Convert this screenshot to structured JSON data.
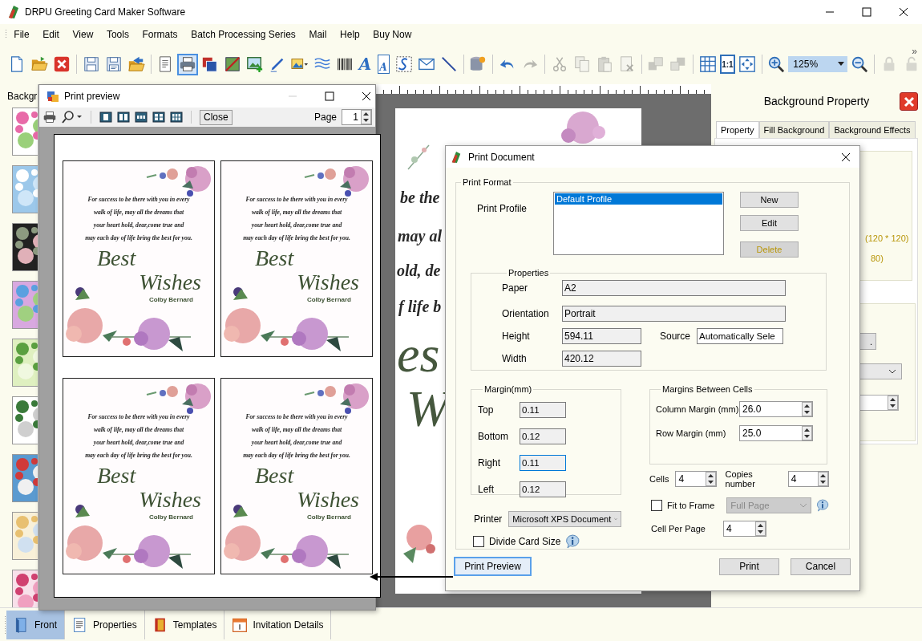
{
  "window": {
    "title": "DRPU Greeting Card Maker Software"
  },
  "menu": [
    "File",
    "Edit",
    "View",
    "Tools",
    "Formats",
    "Batch Processing Series",
    "Mail",
    "Help",
    "Buy Now"
  ],
  "toolbar": {
    "overflow": "»",
    "groups": [
      [
        {
          "kind": "button",
          "selected": false,
          "disabled": false
        },
        {
          "kind": "button",
          "selected": false,
          "disabled": false
        },
        {
          "kind": "button",
          "selected": false,
          "disabled": false
        }
      ],
      [
        {
          "kind": "button",
          "selected": false,
          "disabled": false
        },
        {
          "kind": "button",
          "selected": false,
          "disabled": false
        },
        {
          "kind": "button",
          "selected": false,
          "disabled": false
        }
      ],
      [
        {
          "kind": "button",
          "selected": false,
          "disabled": false
        },
        {
          "kind": "button",
          "selected": true,
          "disabled": false
        },
        {
          "kind": "button",
          "selected": false,
          "disabled": false
        },
        {
          "kind": "button",
          "selected": false,
          "disabled": false
        },
        {
          "kind": "button",
          "selected": false,
          "disabled": false
        },
        {
          "kind": "button",
          "selected": false,
          "disabled": false
        },
        {
          "kind": "button",
          "selected": false,
          "disabled": false
        },
        {
          "kind": "button",
          "selected": false,
          "disabled": false
        },
        {
          "kind": "button",
          "selected": false,
          "disabled": false
        },
        {
          "kind": "button",
          "label": "A",
          "selected": false,
          "disabled": false
        },
        {
          "kind": "button",
          "label": "A",
          "selected": false,
          "disabled": false
        },
        {
          "kind": "button",
          "selected": false,
          "disabled": false
        },
        {
          "kind": "button",
          "selected": false,
          "disabled": false
        },
        {
          "kind": "button",
          "selected": false,
          "disabled": false
        }
      ],
      [
        {
          "kind": "button",
          "selected": false,
          "disabled": false
        }
      ],
      [
        {
          "kind": "button",
          "selected": false,
          "disabled": false
        },
        {
          "kind": "button",
          "selected": false,
          "disabled": true
        }
      ],
      [
        {
          "kind": "button",
          "selected": false,
          "disabled": true
        },
        {
          "kind": "button",
          "selected": false,
          "disabled": true
        },
        {
          "kind": "button",
          "selected": false,
          "disabled": true
        },
        {
          "kind": "button",
          "selected": false,
          "disabled": true
        }
      ],
      [
        {
          "kind": "button",
          "selected": false,
          "disabled": true
        },
        {
          "kind": "button",
          "selected": false,
          "disabled": true
        }
      ],
      [
        {
          "kind": "button",
          "selected": false,
          "disabled": false
        },
        {
          "kind": "button",
          "label": "1:1",
          "selected": false,
          "disabled": false
        },
        {
          "kind": "button",
          "selected": false,
          "disabled": false
        }
      ],
      [
        {
          "kind": "button",
          "selected": false,
          "disabled": false
        },
        {
          "kind": "combo",
          "value": "125%"
        },
        {
          "kind": "button",
          "selected": false,
          "disabled": false
        }
      ],
      [
        {
          "kind": "button",
          "selected": false,
          "disabled": true
        },
        {
          "kind": "button",
          "selected": false,
          "disabled": true
        }
      ]
    ]
  },
  "left_panel": {
    "label": "Backgr"
  },
  "canvas": {
    "fragments": [
      {
        "kind": "line",
        "text": "be the"
      },
      {
        "kind": "line",
        "text": "may al"
      },
      {
        "kind": "line",
        "text": "old, de"
      },
      {
        "kind": "line",
        "text": "f life b"
      },
      {
        "kind": "title",
        "text": "es"
      },
      {
        "kind": "title",
        "text": "W"
      }
    ]
  },
  "background_property": {
    "title": "Background Property",
    "tabs": [
      {
        "label": "Property",
        "selected": true
      },
      {
        "label": "Fill Background",
        "selected": false
      },
      {
        "label": "Background Effects",
        "selected": false
      }
    ],
    "size_texts": [
      "(120 * 120)",
      "80)"
    ],
    "more_button": "."
  },
  "print_preview": {
    "title": "Print preview",
    "close_label": "Close",
    "page_label": "Page",
    "page": "1",
    "cards": [
      {
        "quote": [
          "For success to be there with you in every",
          "walk of life, may all the dreams that",
          "your heart hold, dear,come true and",
          "may each day of life bring the best for you."
        ],
        "title": [
          "Best",
          "Wishes"
        ],
        "name": "Colby Bernard"
      },
      {
        "quote": [
          "For success to be there with you in every",
          "walk of life, may all the dreams that",
          "your heart hold, dear,come true and",
          "may each day of life bring the best for you."
        ],
        "title": [
          "Best",
          "Wishes"
        ],
        "name": "Colby Bernard"
      },
      {
        "quote": [
          "For success to be there with you in every",
          "walk of life, may all the dreams that",
          "your heart hold, dear,come true and",
          "may each day of life bring the best for you."
        ],
        "title": [
          "Best",
          "Wishes"
        ],
        "name": "Colby Bernard"
      },
      {
        "quote": [
          "For success to be there with you in every",
          "walk of life, may all the dreams that",
          "your heart hold, dear,come true and",
          "may each day of life bring the best for you."
        ],
        "title": [
          "Best",
          "Wishes"
        ],
        "name": "Colby Bernard"
      }
    ]
  },
  "print_document": {
    "title": "Print Document",
    "format_label": "Print Format",
    "profile_label": "Print Profile",
    "profiles": [
      {
        "name": "Default Profile",
        "selected": true
      }
    ],
    "profile_buttons": [
      {
        "label": "New",
        "disabled": false
      },
      {
        "label": "Edit",
        "disabled": false
      },
      {
        "label": "Delete",
        "disabled": true
      }
    ],
    "properties": {
      "label": "Properties",
      "paper": {
        "label": "Paper",
        "value": "A2"
      },
      "orientation": {
        "label": "Orientation",
        "value": "Portrait"
      },
      "height": {
        "label": "Height",
        "value": "594.11"
      },
      "source": {
        "label": "Source",
        "value": "Automatically Sele"
      },
      "width": {
        "label": "Width",
        "value": "420.12"
      }
    },
    "margin": {
      "label": "Margin(mm)",
      "fields": [
        {
          "label": "Top",
          "value": "0.11",
          "focused": false
        },
        {
          "label": "Bottom",
          "value": "0.12",
          "focused": false
        },
        {
          "label": "Right",
          "value": "0.11",
          "focused": true
        },
        {
          "label": "Left",
          "value": "0.12",
          "focused": false
        }
      ]
    },
    "printer": {
      "label": "Printer",
      "value": "Microsoft XPS Document"
    },
    "divide_card_size": {
      "label": "Divide Card Size",
      "checked": false
    },
    "cell_margins": {
      "label": "Margins Between Cells",
      "fields": [
        {
          "label": "Column Margin (mm)",
          "value": "26.0"
        },
        {
          "label": "Row Margin (mm)",
          "value": "25.0"
        }
      ]
    },
    "cells": {
      "label": "Cells",
      "value": "4"
    },
    "copies": {
      "label": "Copies number",
      "value": "4"
    },
    "fit_to_frame": {
      "label": "Fit to Frame",
      "checked": false
    },
    "fit_mode": {
      "value": "Full Page",
      "disabled": true
    },
    "cell_per_page": {
      "label": "Cell Per Page",
      "value": "4"
    },
    "buttons": [
      {
        "label": "Print Preview",
        "focused": true
      },
      {
        "label": "Print",
        "focused": false
      },
      {
        "label": "Cancel",
        "focused": false
      }
    ]
  },
  "bottom_tabs": [
    {
      "label": "Front",
      "selected": true
    },
    {
      "label": "Properties",
      "selected": false
    },
    {
      "label": "Templates",
      "selected": false
    },
    {
      "label": "Invitation Details",
      "selected": false
    }
  ]
}
